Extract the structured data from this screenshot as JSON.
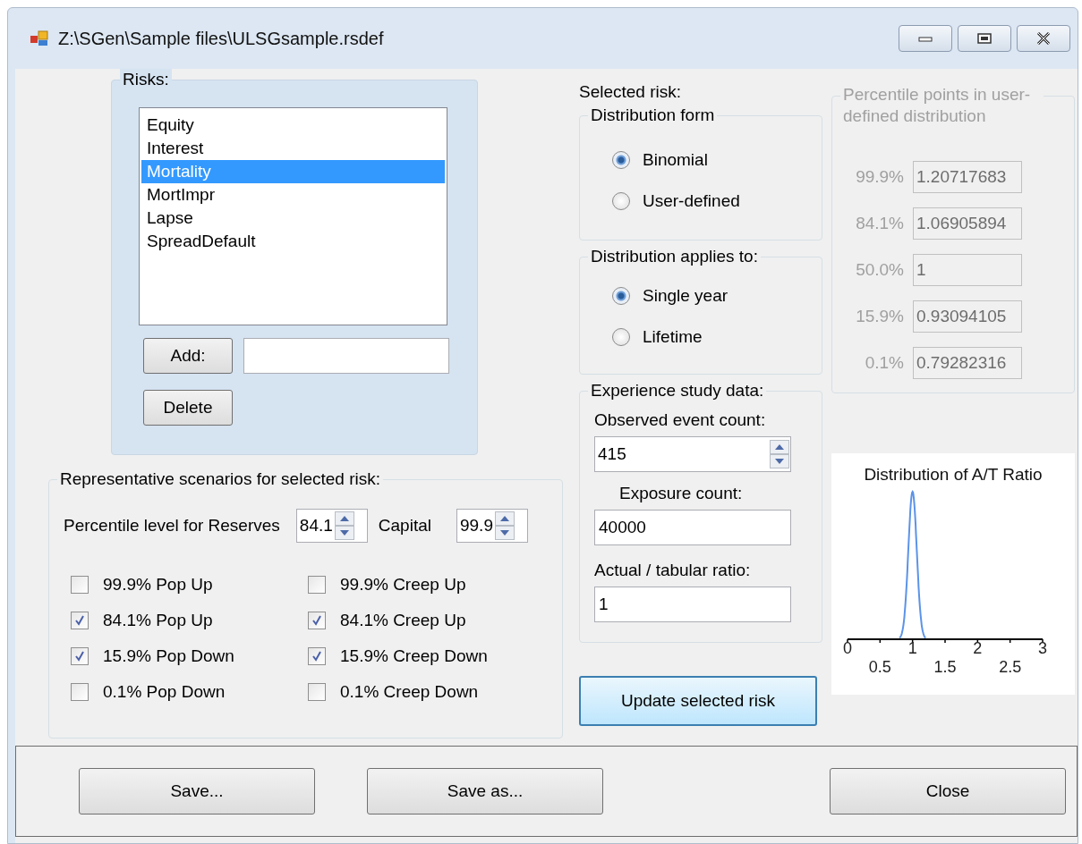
{
  "window": {
    "title": "Z:\\SGen\\Sample files\\ULSGsample.rsdef"
  },
  "risks": {
    "label": "Risks:",
    "items": [
      {
        "label": "Equity",
        "selected": false
      },
      {
        "label": "Interest",
        "selected": false
      },
      {
        "label": "Mortality",
        "selected": true
      },
      {
        "label": "MortImpr",
        "selected": false
      },
      {
        "label": "Lapse",
        "selected": false
      },
      {
        "label": "SpreadDefault",
        "selected": false
      }
    ],
    "add_button": "Add:",
    "delete_button": "Delete"
  },
  "scenarios": {
    "title": "Representative scenarios for selected risk:",
    "reserves_label": "Percentile level for Reserves",
    "reserves_value": "84.1",
    "capital_label": "Capital",
    "capital_value": "99.9",
    "options": [
      {
        "label": "99.9% Pop Up",
        "checked": false
      },
      {
        "label": "99.9% Creep Up",
        "checked": false
      },
      {
        "label": "84.1% Pop Up",
        "checked": true
      },
      {
        "label": "84.1% Creep Up",
        "checked": true
      },
      {
        "label": "15.9% Pop Down",
        "checked": true
      },
      {
        "label": "15.9% Creep Down",
        "checked": true
      },
      {
        "label": "0.1% Pop Down",
        "checked": false
      },
      {
        "label": "0.1% Creep Down",
        "checked": false
      }
    ]
  },
  "selected_risk": {
    "label": "Selected risk:",
    "distribution_form": {
      "title": "Distribution form",
      "options": [
        {
          "label": "Binomial",
          "selected": true
        },
        {
          "label": "User-defined",
          "selected": false
        }
      ]
    },
    "applies_to": {
      "title": "Distribution applies to:",
      "options": [
        {
          "label": "Single year",
          "selected": true
        },
        {
          "label": "Lifetime",
          "selected": false
        }
      ]
    },
    "experience": {
      "title": "Experience study data:",
      "observed_label": "Observed event count:",
      "observed_value": "415",
      "exposure_label": "Exposure count:",
      "exposure_value": "40000",
      "ratio_label": "Actual / tabular ratio:",
      "ratio_value": "1"
    },
    "update_button": "Update selected risk"
  },
  "percentiles": {
    "title": "Percentile points in user-defined distribution",
    "disabled": true,
    "rows": [
      {
        "label": "99.9%",
        "value": "1.20717683"
      },
      {
        "label": "84.1%",
        "value": "1.06905894"
      },
      {
        "label": "50.0%",
        "value": "1"
      },
      {
        "label": "15.9%",
        "value": "0.93094105"
      },
      {
        "label": "0.1%",
        "value": "0.79282316"
      }
    ]
  },
  "chart": {
    "title": "Distribution of A/T Ratio",
    "tick_labels": [
      "0",
      "0.5",
      "1",
      "1.5",
      "2",
      "2.5",
      "3"
    ]
  },
  "buttons": [
    {
      "label": "Save..."
    },
    {
      "label": "Save as..."
    },
    {
      "label": "Close"
    }
  ]
}
